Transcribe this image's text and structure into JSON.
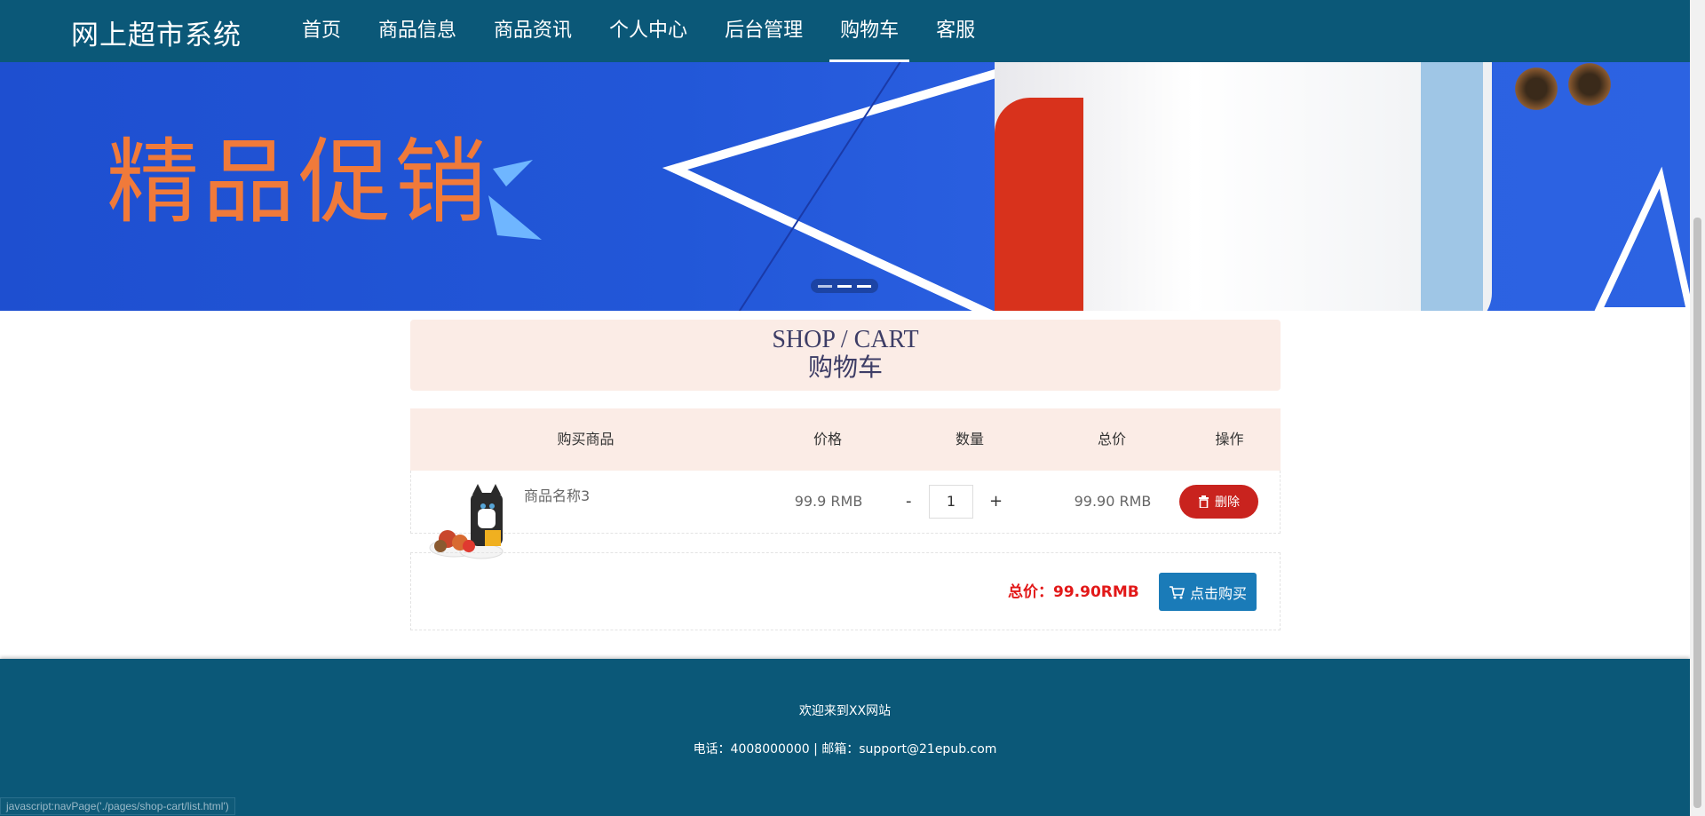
{
  "nav": {
    "brand": "网上超市系统",
    "items": [
      {
        "label": "首页"
      },
      {
        "label": "商品信息"
      },
      {
        "label": "商品资讯"
      },
      {
        "label": "个人中心"
      },
      {
        "label": "后台管理"
      },
      {
        "label": "购物车",
        "active": true
      },
      {
        "label": "客服"
      }
    ]
  },
  "banner": {
    "text": "精品促销"
  },
  "cart": {
    "title_en": "SHOP / CART",
    "title_cn": "购物车",
    "headers": {
      "product": "购买商品",
      "price": "价格",
      "quantity": "数量",
      "total": "总价",
      "action": "操作"
    },
    "items": [
      {
        "name": "商品名称3",
        "price": "99.9 RMB",
        "quantity": "1",
        "minus": "-",
        "plus": "+",
        "total": "99.90 RMB",
        "delete_label": "删除"
      }
    ],
    "summary": {
      "total_text": "总价：99.90RMB",
      "buy_label": "点击购买"
    }
  },
  "footer": {
    "welcome": "欢迎来到XX网站",
    "contact": "电话：4008000000 | 邮箱：support@21epub.com"
  },
  "status_bar": "javascript:navPage('./pages/shop-cart/list.html')",
  "colors": {
    "nav_bg": "#0b5878",
    "cart_header_bg": "#fbece6",
    "delete_red": "#c9231e",
    "buy_blue": "#1a7bb8",
    "total_red": "#e21818"
  }
}
